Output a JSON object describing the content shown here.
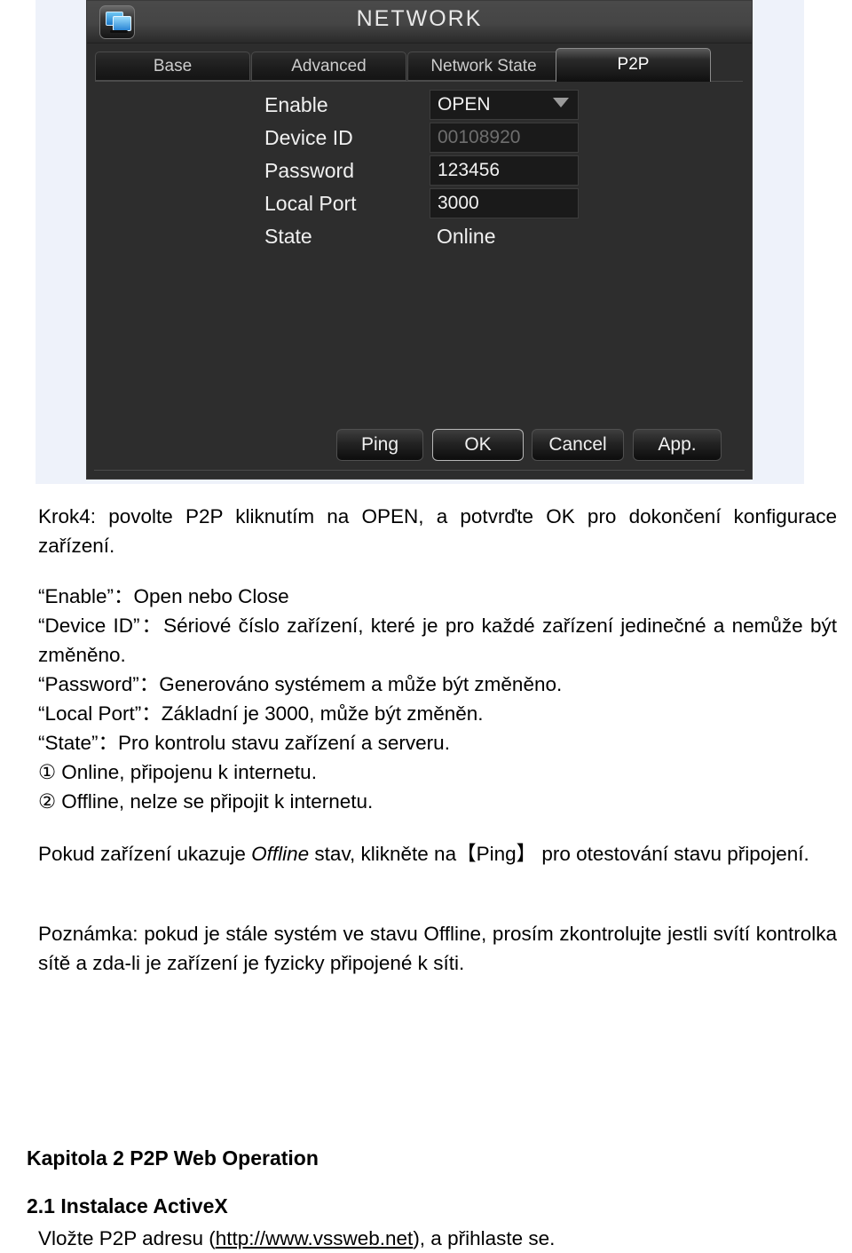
{
  "device_screenshot": {
    "app_icon": "network-monitors-icon",
    "title": "NETWORK",
    "tabs": [
      {
        "label": "Base",
        "active": false
      },
      {
        "label": "Advanced",
        "active": false
      },
      {
        "label": "Network State",
        "active": false
      },
      {
        "label": "P2P",
        "active": true
      }
    ],
    "form": [
      {
        "label": "Enable",
        "value": "OPEN",
        "type": "dropdown"
      },
      {
        "label": "Device ID",
        "value": "00108920",
        "type": "readonly-input"
      },
      {
        "label": "Password",
        "value": "123456",
        "type": "input"
      },
      {
        "label": "Local Port",
        "value": "3000",
        "type": "input"
      },
      {
        "label": "State",
        "value": "Online",
        "type": "static"
      }
    ],
    "buttons": [
      {
        "label": "Ping",
        "focused": false
      },
      {
        "label": "OK",
        "focused": true
      },
      {
        "label": "Cancel",
        "focused": false
      },
      {
        "label": "App.",
        "focused": false
      }
    ],
    "colors": {
      "panel_bg": "#2d2d2d",
      "field_bg": "#1a1a1a",
      "text": "#f0f0f0",
      "readonly_text": "#6e6e6e",
      "page_margin": "#eef2fa"
    }
  },
  "document": {
    "step4": "Krok4: povolte P2P kliknutím na OPEN, a potvrďte OK pro dokončení konfigurace zařízení.",
    "defs": {
      "enable": "“Enable”：Open nebo Close",
      "device_id": "“Device ID”：Sériové číslo zařízení, které je pro každé zařízení jedinečné a nemůže být změněno.",
      "password": "“Password”：Generováno systémem a může být změněno.",
      "local_port": "“Local Port”：Základní je 3000, může být změněn.",
      "state": "“State”：Pro kontrolu stavu zařízení a serveru."
    },
    "state_items": [
      {
        "num": "①",
        "text": "Online, připojenu k internetu."
      },
      {
        "num": "②",
        "text": "Offline, nelze se připojit k internetu."
      }
    ],
    "ping_note": {
      "pre": "Pokud zařízení ukazuje ",
      "italic": "Offline",
      "mid": " stav, klikněte na【Ping】 pro otestování stavu připojení."
    },
    "poznamka": "Poznámka: pokud je stále systém ve stavu Offline, prosím zkontrolujte jestli svítí kontrolka sítě a zda-li je zařízení je fyzicky připojené k síti.",
    "chapter_heading": "Kapitola 2 P2P Web Operation",
    "section_heading": "2.1 Instalace ActiveX",
    "section_body": {
      "pre": "Vložte P2P adresu (",
      "link": "http://www.vssweb.net",
      "post": "), a přihlaste se."
    }
  }
}
